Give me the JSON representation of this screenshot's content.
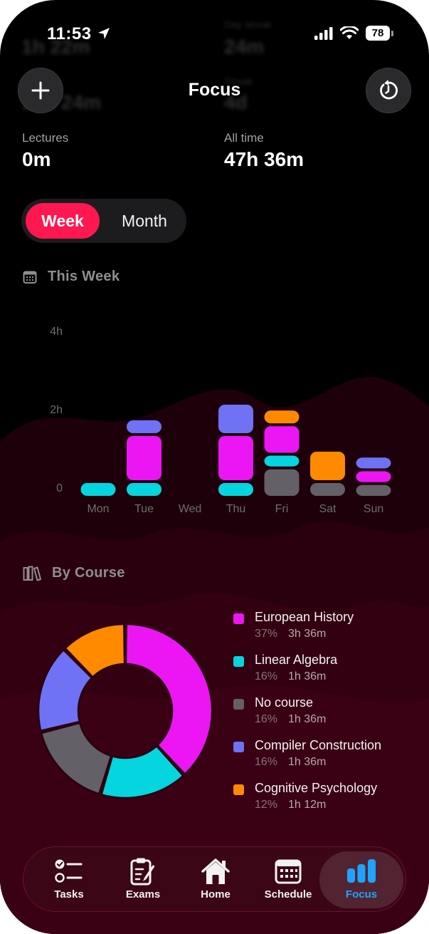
{
  "status_bar": {
    "time": "11:53",
    "battery": "78"
  },
  "ghost_stats": {
    "left_value_1": "1h 22m",
    "right_label": "Day streak",
    "right_value_1": "24m",
    "left_value_2": "10h 24m",
    "right_label_2": "Streak",
    "right_value_2": "4d"
  },
  "header": {
    "title": "Focus",
    "add_icon": "plus-icon",
    "reset_icon": "reset-icon"
  },
  "stats": [
    {
      "label": "Lectures",
      "value": "0m"
    },
    {
      "label": "All time",
      "value": "47h 36m"
    }
  ],
  "segmented": {
    "week": "Week",
    "month": "Month",
    "selected": "Week"
  },
  "this_week": {
    "title": "This Week",
    "icon": "calendar-icon"
  },
  "by_course": {
    "title": "By Course",
    "icon": "books-icon"
  },
  "colors": {
    "accent": "#ff1750",
    "European History": "#ec16f5",
    "Linear Algebra": "#05d5df",
    "No course": "#646068",
    "Compiler Construction": "#6f72f4",
    "Cognitive Psychology": "#ff8a00",
    "tab_active": "#1ea4ff"
  },
  "chart_data": {
    "type": "bar",
    "stacked": true,
    "y_unit": "h",
    "yticks": [
      "4h",
      "2h",
      "0"
    ],
    "ylim": [
      0,
      4
    ],
    "categories": [
      "Mon",
      "Tue",
      "Wed",
      "Thu",
      "Fri",
      "Sat",
      "Sun"
    ],
    "series": [
      {
        "name": "European History",
        "values": [
          0,
          1.2,
          0,
          1.2,
          0.75,
          0,
          0.35
        ]
      },
      {
        "name": "Linear Algebra",
        "values": [
          0.4,
          0.4,
          0,
          0.4,
          0.35,
          0,
          0
        ]
      },
      {
        "name": "No course",
        "values": [
          0,
          0,
          0,
          0,
          0.75,
          0.4,
          0.35
        ]
      },
      {
        "name": "Compiler Construction",
        "values": [
          0,
          0.4,
          0,
          0.8,
          0,
          0,
          0.35
        ]
      },
      {
        "name": "Cognitive Psychology",
        "values": [
          0,
          0,
          0,
          0,
          0.4,
          0.8,
          0
        ]
      }
    ],
    "stack_order": [
      [
        "Linear Algebra"
      ],
      [
        "Linear Algebra",
        "European History",
        "Compiler Construction"
      ],
      [],
      [
        "Linear Algebra",
        "European History",
        "Compiler Construction"
      ],
      [
        "No course",
        "Linear Algebra",
        "European History",
        "Cognitive Psychology"
      ],
      [
        "No course",
        "Cognitive Psychology"
      ],
      [
        "No course",
        "European History",
        "Compiler Construction"
      ]
    ]
  },
  "courses": [
    {
      "name": "European History",
      "percent": "37%",
      "duration": "3h 36m",
      "share": 37
    },
    {
      "name": "Linear Algebra",
      "percent": "16%",
      "duration": "1h 36m",
      "share": 16
    },
    {
      "name": "No course",
      "percent": "16%",
      "duration": "1h 36m",
      "share": 16
    },
    {
      "name": "Compiler Construction",
      "percent": "16%",
      "duration": "1h 36m",
      "share": 16
    },
    {
      "name": "Cognitive Psychology",
      "percent": "12%",
      "duration": "1h 12m",
      "share": 12
    }
  ],
  "tabs": [
    {
      "label": "Tasks",
      "icon": "tasks-icon",
      "active": false
    },
    {
      "label": "Exams",
      "icon": "exam-clipboard-icon",
      "active": false
    },
    {
      "label": "Home",
      "icon": "home-icon",
      "active": false
    },
    {
      "label": "Schedule",
      "icon": "schedule-icon",
      "active": false
    },
    {
      "label": "Focus",
      "icon": "bar-chart-icon",
      "active": true
    }
  ]
}
